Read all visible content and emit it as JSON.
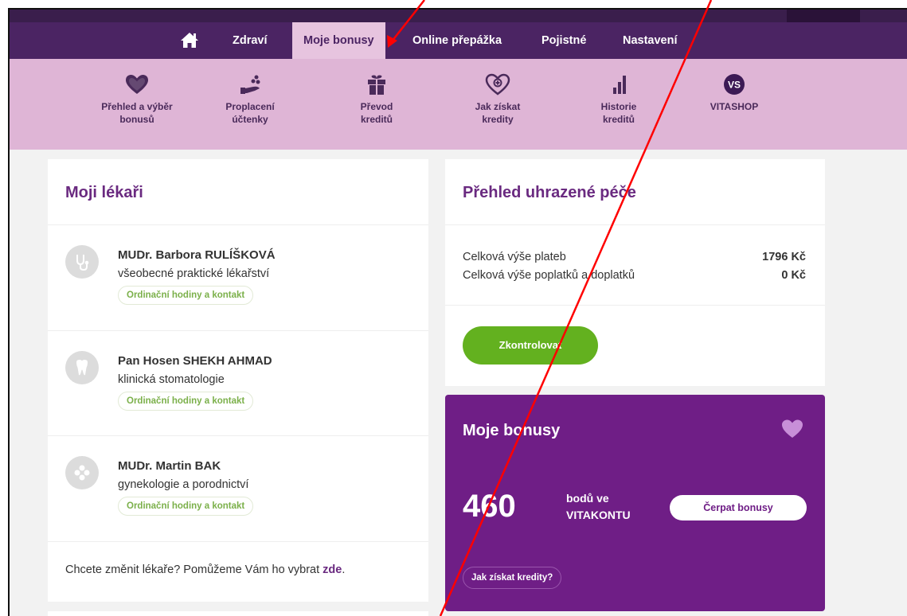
{
  "nav": {
    "items": [
      {
        "label": "Zdraví"
      },
      {
        "label": "Moje bonusy",
        "active": true
      },
      {
        "label": "Online přepážka"
      },
      {
        "label": "Pojistné"
      },
      {
        "label": "Nastavení"
      }
    ]
  },
  "subnav": {
    "items": [
      {
        "label": "Přehled a výběr\nbonusů",
        "icon": "heart-icon"
      },
      {
        "label": "Proplacení\núčtenky",
        "icon": "hand-coins-icon"
      },
      {
        "label": "Převod\nkreditů",
        "icon": "gift-icon"
      },
      {
        "label": "Jak získat\nkredity",
        "icon": "heart-plus-icon"
      },
      {
        "label": "Historie\nkreditů",
        "icon": "bar-chart-icon"
      },
      {
        "label": "VITASHOP",
        "icon": "vs-logo-icon",
        "icon_text": "VS"
      }
    ]
  },
  "doctors": {
    "title": "Moji lékaři",
    "items": [
      {
        "name": "MUDr. Barbora RULÍŠKOVÁ",
        "spec": "všeobecné praktické lékařství",
        "contact": "Ordinační hodiny a kontakt",
        "icon": "stethoscope-icon"
      },
      {
        "name": "Pan Hosen SHEKH AHMAD",
        "spec": "klinická stomatologie",
        "contact": "Ordinační hodiny a kontakt",
        "icon": "tooth-icon"
      },
      {
        "name": "MUDr. Martin BAK",
        "spec": "gynekologie a porodnictví",
        "contact": "Ordinační hodiny a kontakt",
        "icon": "flower-icon"
      }
    ],
    "change_text": "Chcete změnit lékaře? Pomůžeme Vám ho vybrat ",
    "change_link": "zde",
    "change_end": "."
  },
  "care": {
    "title": "Přehled uhrazené péče",
    "rows": [
      {
        "label": "Celková výše plateb",
        "value": "1796 Kč"
      },
      {
        "label": "Celková výše poplatků a doplatků",
        "value": "0 Kč"
      }
    ],
    "button": "Zkontrolovat"
  },
  "bonus": {
    "title": "Moje bonusy",
    "points": "460",
    "points_text": "bodů ve\nVITAKONTU",
    "button": "Čerpat bonusy",
    "link": "Jak získat kredity?"
  },
  "colors": {
    "nav_bg": "#4b2463",
    "subnav_bg": "#dfb5d6",
    "accent_purple": "#6f1e86",
    "accent_green": "#63b11f",
    "annotation_arrow": "#ff0000"
  }
}
